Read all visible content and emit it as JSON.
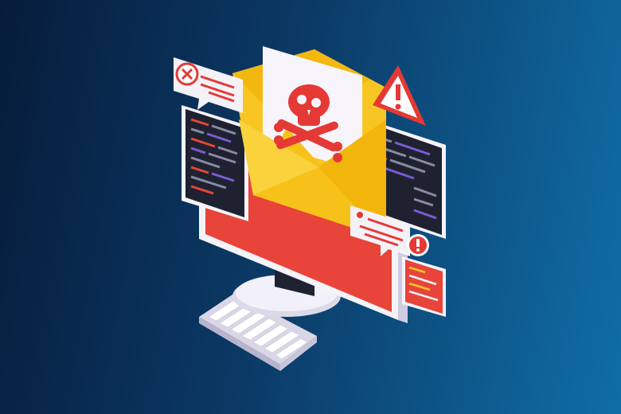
{
  "scene": {
    "description_icons": [
      "error-x-icon",
      "warning-triangle-icon",
      "exclamation-icon",
      "skull-crossbones-icon",
      "envelope-icon",
      "keyboard-icon",
      "monitor-icon"
    ]
  },
  "colors": {
    "background_left": "#061c3b",
    "background_right": "#0f6ea6",
    "alert_red": "#e53935",
    "envelope_yellow": "#f6c21a",
    "monitor_red": "#e8443a",
    "code_panel": "#1e2230",
    "bubble_white": "#f4f2f7"
  }
}
